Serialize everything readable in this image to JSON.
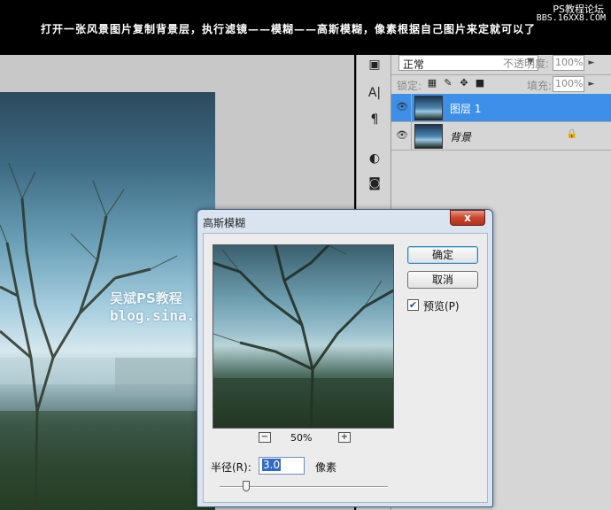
{
  "banner": {
    "instruction": "打开一张风景图片复制背景层，执行滤镜——模糊——高斯模糊，像素根据自己图片来定就可以了",
    "forum_name": "PS教程论坛",
    "forum_url": "BBS.16XX8.COM"
  },
  "watermark": {
    "line1": "吴斌PS教程",
    "line2": "blog.sina.com.cn/cgwubin"
  },
  "layers_panel": {
    "blend_mode": "正常",
    "opacity_label": "不透明度:",
    "opacity_value": "100%",
    "lock_label": "锁定:",
    "fill_label": "填充:",
    "fill_value": "100%",
    "layers": [
      {
        "name": "图层 1",
        "selected": true
      },
      {
        "name": "背景",
        "selected": false,
        "locked": true
      }
    ]
  },
  "tool_icons": [
    "character-panel-icon",
    "paragraph-icon",
    "adjustment-icon",
    "mask-icon"
  ],
  "dialog": {
    "title": "高斯模糊",
    "close_symbol": "x",
    "ok_label": "确定",
    "cancel_label": "取消",
    "preview_label": "预览(P)",
    "preview_checked": true,
    "zoom_value": "50%",
    "zoom_out_symbol": "−",
    "zoom_in_symbol": "+",
    "radius_label": "半径(R):",
    "radius_value": "3.0",
    "radius_unit": "像素"
  },
  "colors": {
    "selected_layer": "#3d8fe8",
    "close_button": "#c8452f"
  }
}
